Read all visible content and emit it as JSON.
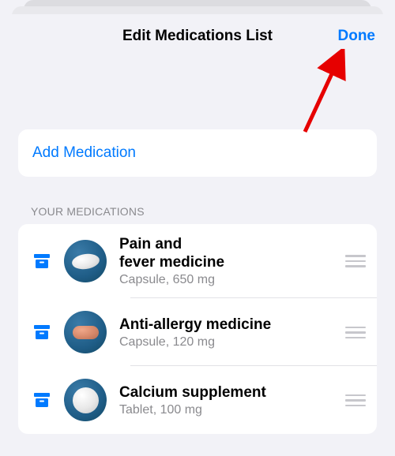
{
  "header": {
    "title": "Edit Medications List",
    "done_label": "Done"
  },
  "add_button_label": "Add Medication",
  "section_label": "YOUR MEDICATIONS",
  "medications": [
    {
      "name": "Pain and\nfever medicine",
      "subtitle": "Capsule, 650 mg"
    },
    {
      "name": "Anti-allergy medicine",
      "subtitle": "Capsule, 120 mg"
    },
    {
      "name": "Calcium supplement",
      "subtitle": "Tablet, 100 mg"
    }
  ],
  "colors": {
    "accent": "#007aff"
  }
}
